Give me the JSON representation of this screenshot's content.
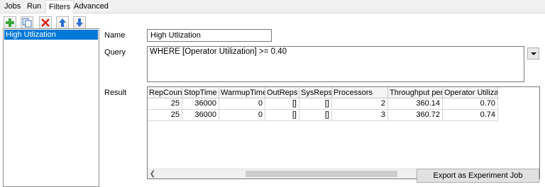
{
  "tabs": [
    {
      "label": "Jobs"
    },
    {
      "label": "Run"
    },
    {
      "label": "Filters"
    },
    {
      "label": "Advanced"
    }
  ],
  "toolbar": {
    "icons": [
      "add-icon",
      "copy-icon",
      "delete-icon",
      "move-up-icon",
      "move-down-icon"
    ],
    "colors": {
      "add": "#3aa839",
      "delete": "#e0231a",
      "arrow": "#2a6fd6"
    }
  },
  "filters": {
    "items": [
      {
        "label": "High Utlization"
      }
    ],
    "selected_color": "#0078d7"
  },
  "form": {
    "name_label": "Name",
    "name_value": "High Utlization",
    "query_label": "Query",
    "query_value": "WHERE [Operator Utilization] >= 0.40",
    "result_label": "Result"
  },
  "result_table": {
    "columns": [
      "RepCount",
      "StopTime",
      "WarmupTime",
      "OutReps",
      "SysReps",
      "Processors",
      "Throughput per H",
      "Operator Utilizatio"
    ],
    "rows": [
      [
        "25",
        "36000",
        "0",
        "[]",
        "[]",
        "2",
        "360.14",
        "0.70"
      ],
      [
        "25",
        "36000",
        "0",
        "[]",
        "[]",
        "3",
        "360.72",
        "0.74"
      ]
    ]
  },
  "export_button": {
    "label": "Export as Experiment Job"
  }
}
